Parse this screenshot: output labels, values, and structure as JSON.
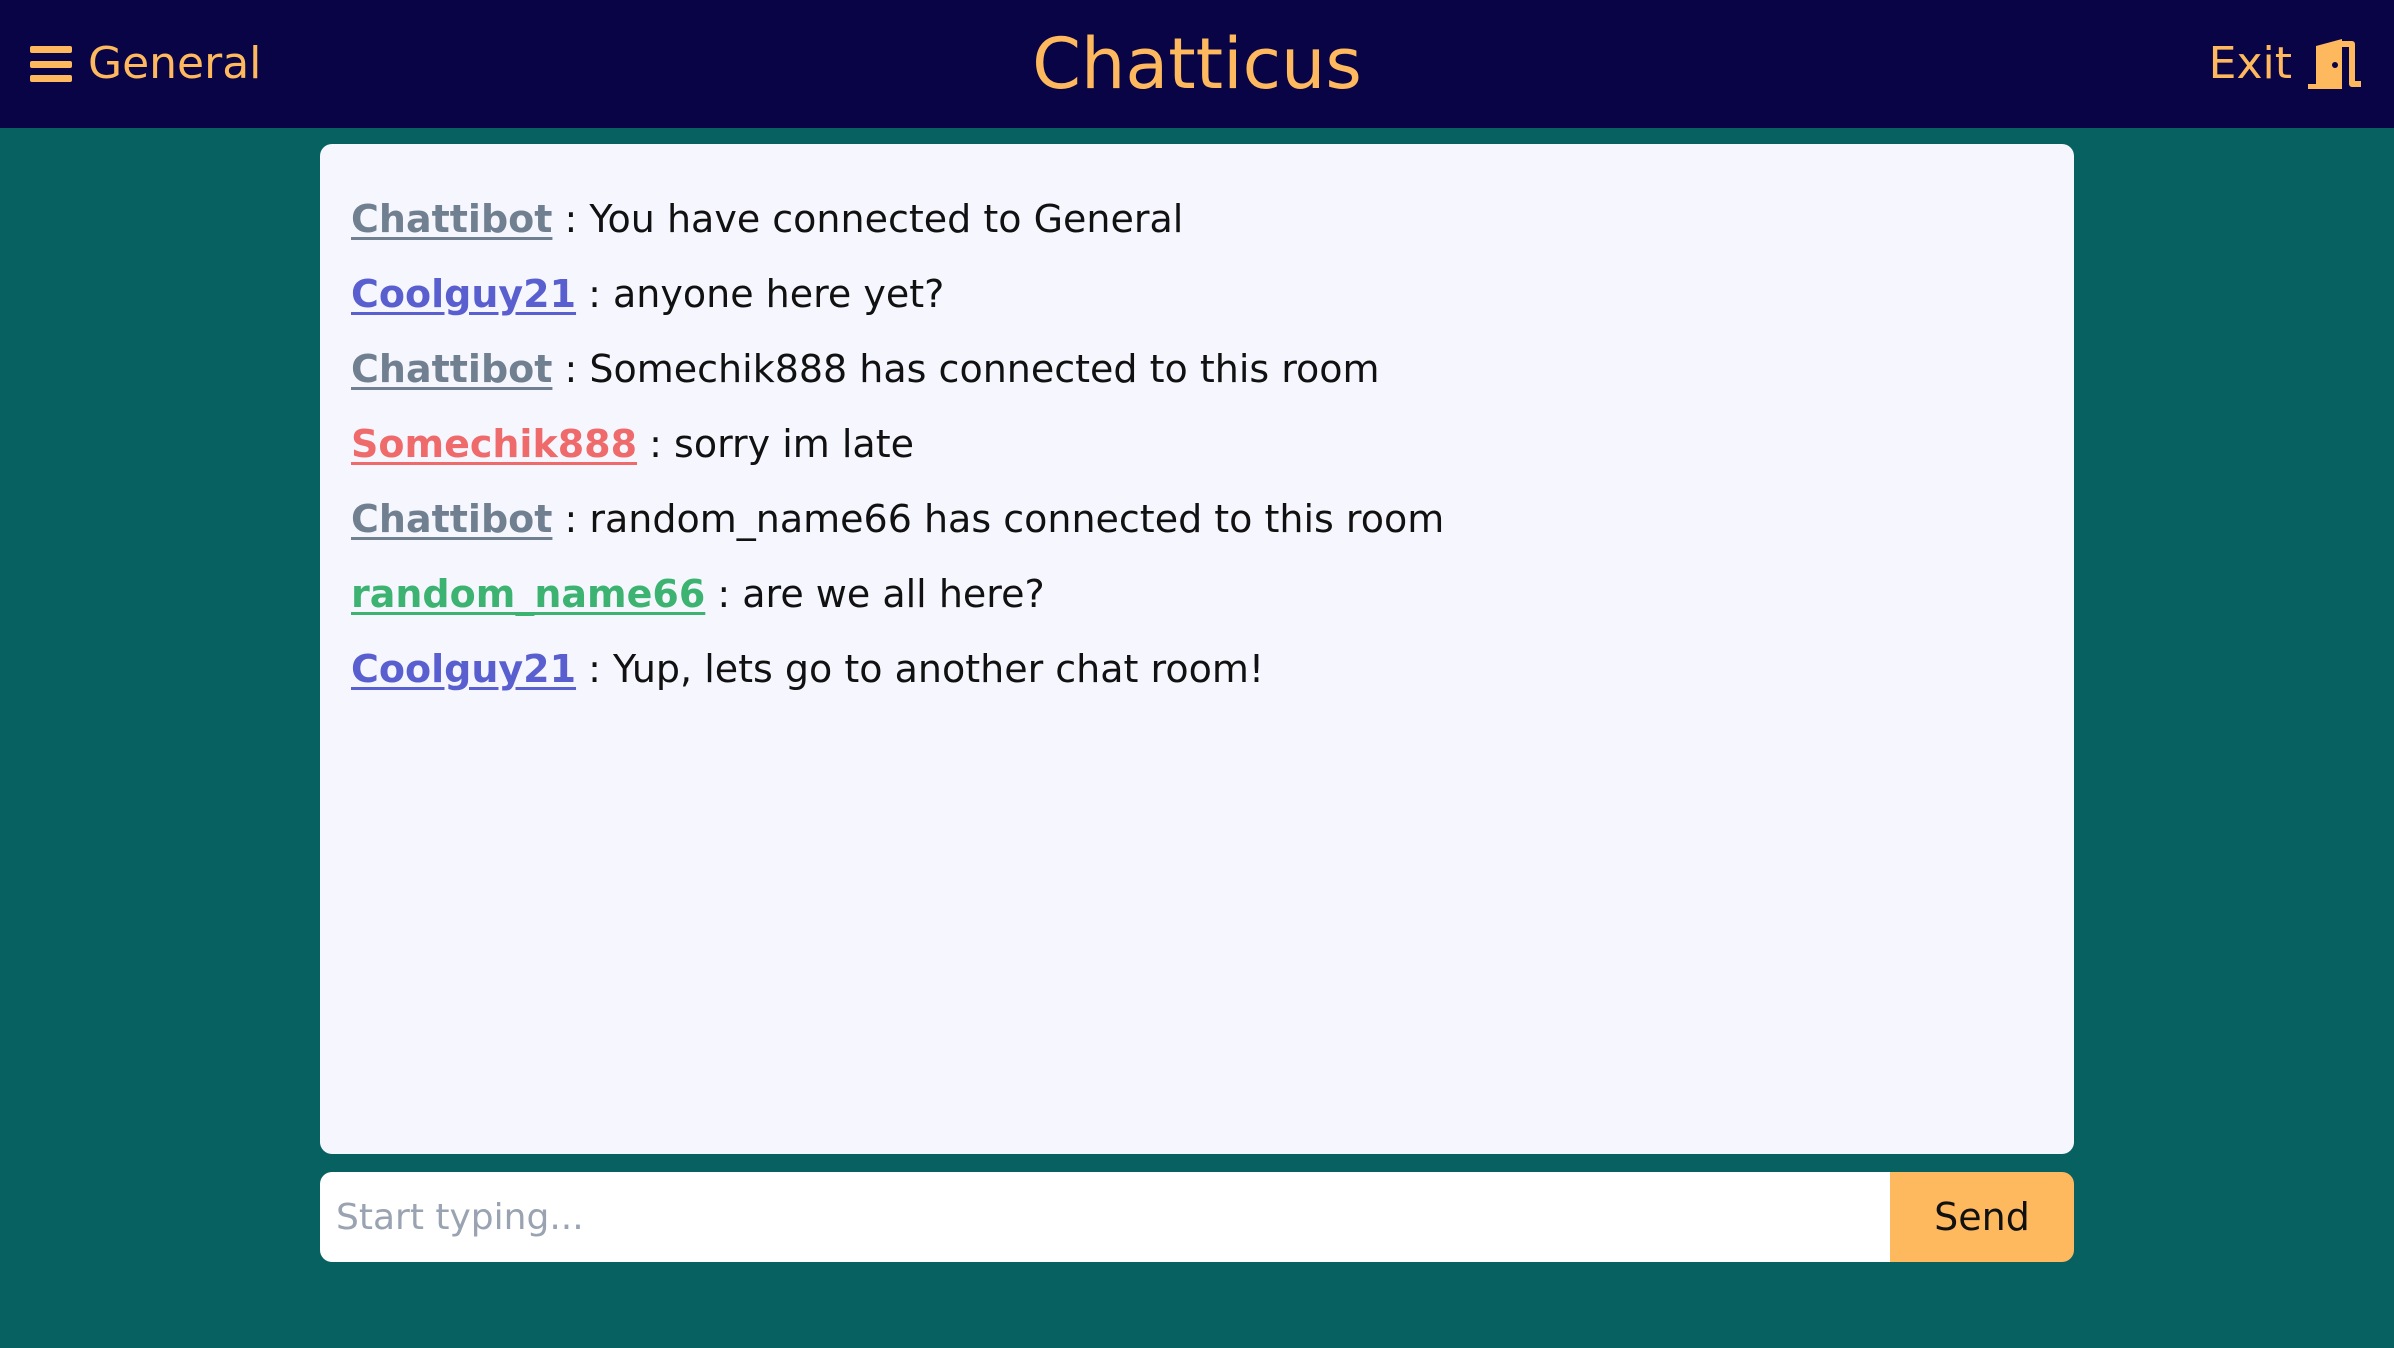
{
  "header": {
    "room_name": "General",
    "app_title": "Chatticus",
    "exit_label": "Exit"
  },
  "icons": {
    "menu": "hamburger-menu-icon",
    "exit": "door-exit-icon"
  },
  "colors": {
    "header_bg": "#090446",
    "accent": "#feb95f",
    "page_bg": "#086161",
    "chat_bg": "#f6f7fe",
    "user_chattibot": "#708090",
    "user_coolguy21": "#5a5fd0",
    "user_somechik888": "#ef6b6b",
    "user_random_name66": "#3cb371"
  },
  "messages": [
    {
      "author": "Chattibot",
      "separator": " : ",
      "text": "You have connected to General",
      "color": "#708090"
    },
    {
      "author": "Coolguy21",
      "separator": " : ",
      "text": "anyone here yet?",
      "color": "#5a5fd0"
    },
    {
      "author": "Chattibot",
      "separator": " : ",
      "text": "Somechik888 has connected to this room",
      "color": "#708090"
    },
    {
      "author": "Somechik888",
      "separator": " : ",
      "text": "sorry im late",
      "color": "#ef6b6b"
    },
    {
      "author": "Chattibot",
      "separator": " : ",
      "text": "random_name66 has connected to this room",
      "color": "#708090"
    },
    {
      "author": "random_name66",
      "separator": " : ",
      "text": "are we all here?",
      "color": "#3cb371"
    },
    {
      "author": "Coolguy21",
      "separator": " : ",
      "text": "Yup, lets go to another chat room!",
      "color": "#5a5fd0"
    }
  ],
  "composer": {
    "placeholder": "Start typing...",
    "value": "",
    "send_label": "Send"
  }
}
